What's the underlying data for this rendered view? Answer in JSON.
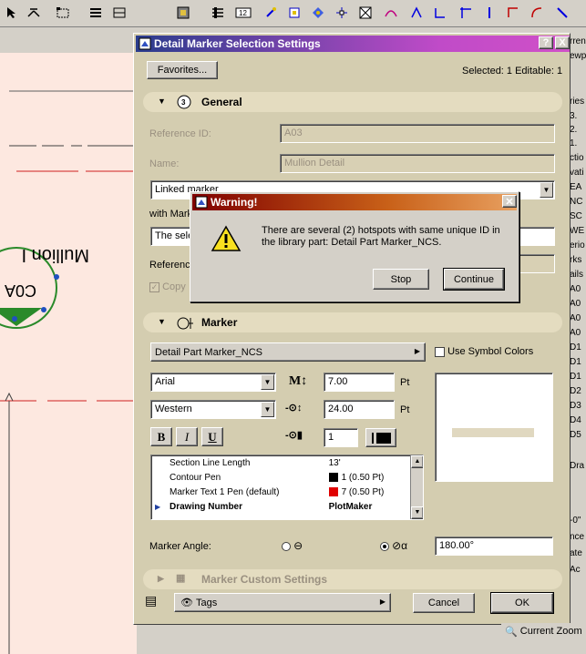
{
  "toolbar": {
    "icons": [
      "arrow-tool",
      "pointer-tool",
      "marquee-tool",
      "layer-tool",
      "pen-tool",
      "fill-tool",
      "layout-tool",
      "dimension-tool",
      "snap-tool",
      "hotspot-tool",
      "node-tool",
      "grid-tool",
      "trace-tool",
      "curve-tool",
      "arc-tool",
      "corner-tool"
    ]
  },
  "canvas": {
    "marker_label": "Mullion I",
    "marker_id": "C0A"
  },
  "palette": {
    "items": [
      "..."
    ]
  },
  "right_panel": {
    "items": [
      "rren",
      "ewp",
      "ries",
      "3.",
      "2.",
      "1.",
      "ctio",
      "vati",
      "EA",
      "NC",
      "SC",
      "WE",
      "erio",
      "rks",
      "ails",
      "A0",
      "A0",
      "A0",
      "A0",
      "D1",
      "D1",
      "D1",
      "D2",
      "D3",
      "D4",
      "D5"
    ],
    "bottom_items": [
      "Dra",
      "-0\"",
      "nce",
      "ate",
      "Ac"
    ],
    "zoom_label": "Current Zoom"
  },
  "dialog": {
    "title": "Detail Marker Selection Settings",
    "help_btn": "?",
    "close_btn": "X",
    "favorites_btn": "Favorites...",
    "selection_status": "Selected: 1 Editable: 1",
    "general": {
      "header": "General",
      "reference_id_label": "Reference ID:",
      "reference_id_value": "A03",
      "name_label": "Name:",
      "name_value": "Mullion Detail",
      "link_type": "Linked marker",
      "with_marker_label": "with Mark",
      "linked_to_value": "The sele",
      "reference_label": "Referenc",
      "copy_label": "Copy"
    },
    "marker": {
      "header": "Marker",
      "part": "Detail Part Marker_NCS",
      "use_symbol_colors": "Use Symbol Colors",
      "font": "Arial",
      "text_size": "7.00",
      "text_unit": "Pt",
      "encoding": "Western",
      "marker_size": "24.00",
      "marker_unit": "Pt",
      "bold": "B",
      "italic": "I",
      "underline": "U",
      "pen_value": "1",
      "params": [
        {
          "name": "Section Line Length",
          "value": "13'"
        },
        {
          "name": "Contour Pen",
          "value": "1 (0.50 Pt)",
          "color": "#000000"
        },
        {
          "name": "Marker Text 1 Pen (default)",
          "value": "7 (0.50 Pt)",
          "color": "#e00000"
        },
        {
          "name": "Drawing Number",
          "value": "PlotMaker",
          "bold": true
        }
      ],
      "angle_label": "Marker Angle:",
      "angle_value": "180.00°"
    },
    "custom_header": "Marker Custom Settings",
    "tags_label": "Tags",
    "cancel_btn": "Cancel",
    "ok_btn": "OK"
  },
  "warning": {
    "title": "Warning!",
    "message": "There are several (2) hotspots with same unique ID in the library part: Detail Part Marker_NCS.",
    "stop_btn": "Stop",
    "continue_btn": "Continue"
  }
}
